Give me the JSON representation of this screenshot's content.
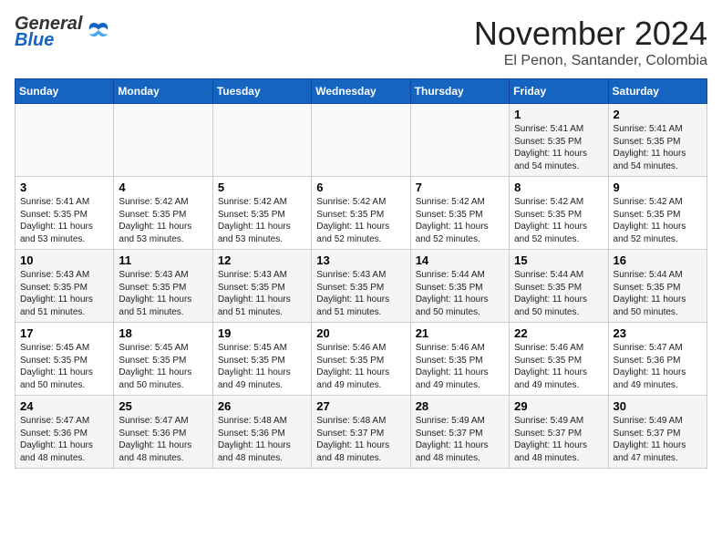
{
  "header": {
    "logo_general": "General",
    "logo_blue": "Blue",
    "month": "November 2024",
    "location": "El Penon, Santander, Colombia"
  },
  "weekdays": [
    "Sunday",
    "Monday",
    "Tuesday",
    "Wednesday",
    "Thursday",
    "Friday",
    "Saturday"
  ],
  "weeks": [
    [
      {
        "day": "",
        "info": ""
      },
      {
        "day": "",
        "info": ""
      },
      {
        "day": "",
        "info": ""
      },
      {
        "day": "",
        "info": ""
      },
      {
        "day": "",
        "info": ""
      },
      {
        "day": "1",
        "info": "Sunrise: 5:41 AM\nSunset: 5:35 PM\nDaylight: 11 hours and 54 minutes."
      },
      {
        "day": "2",
        "info": "Sunrise: 5:41 AM\nSunset: 5:35 PM\nDaylight: 11 hours and 54 minutes."
      }
    ],
    [
      {
        "day": "3",
        "info": "Sunrise: 5:41 AM\nSunset: 5:35 PM\nDaylight: 11 hours and 53 minutes."
      },
      {
        "day": "4",
        "info": "Sunrise: 5:42 AM\nSunset: 5:35 PM\nDaylight: 11 hours and 53 minutes."
      },
      {
        "day": "5",
        "info": "Sunrise: 5:42 AM\nSunset: 5:35 PM\nDaylight: 11 hours and 53 minutes."
      },
      {
        "day": "6",
        "info": "Sunrise: 5:42 AM\nSunset: 5:35 PM\nDaylight: 11 hours and 52 minutes."
      },
      {
        "day": "7",
        "info": "Sunrise: 5:42 AM\nSunset: 5:35 PM\nDaylight: 11 hours and 52 minutes."
      },
      {
        "day": "8",
        "info": "Sunrise: 5:42 AM\nSunset: 5:35 PM\nDaylight: 11 hours and 52 minutes."
      },
      {
        "day": "9",
        "info": "Sunrise: 5:42 AM\nSunset: 5:35 PM\nDaylight: 11 hours and 52 minutes."
      }
    ],
    [
      {
        "day": "10",
        "info": "Sunrise: 5:43 AM\nSunset: 5:35 PM\nDaylight: 11 hours and 51 minutes."
      },
      {
        "day": "11",
        "info": "Sunrise: 5:43 AM\nSunset: 5:35 PM\nDaylight: 11 hours and 51 minutes."
      },
      {
        "day": "12",
        "info": "Sunrise: 5:43 AM\nSunset: 5:35 PM\nDaylight: 11 hours and 51 minutes."
      },
      {
        "day": "13",
        "info": "Sunrise: 5:43 AM\nSunset: 5:35 PM\nDaylight: 11 hours and 51 minutes."
      },
      {
        "day": "14",
        "info": "Sunrise: 5:44 AM\nSunset: 5:35 PM\nDaylight: 11 hours and 50 minutes."
      },
      {
        "day": "15",
        "info": "Sunrise: 5:44 AM\nSunset: 5:35 PM\nDaylight: 11 hours and 50 minutes."
      },
      {
        "day": "16",
        "info": "Sunrise: 5:44 AM\nSunset: 5:35 PM\nDaylight: 11 hours and 50 minutes."
      }
    ],
    [
      {
        "day": "17",
        "info": "Sunrise: 5:45 AM\nSunset: 5:35 PM\nDaylight: 11 hours and 50 minutes."
      },
      {
        "day": "18",
        "info": "Sunrise: 5:45 AM\nSunset: 5:35 PM\nDaylight: 11 hours and 50 minutes."
      },
      {
        "day": "19",
        "info": "Sunrise: 5:45 AM\nSunset: 5:35 PM\nDaylight: 11 hours and 49 minutes."
      },
      {
        "day": "20",
        "info": "Sunrise: 5:46 AM\nSunset: 5:35 PM\nDaylight: 11 hours and 49 minutes."
      },
      {
        "day": "21",
        "info": "Sunrise: 5:46 AM\nSunset: 5:35 PM\nDaylight: 11 hours and 49 minutes."
      },
      {
        "day": "22",
        "info": "Sunrise: 5:46 AM\nSunset: 5:35 PM\nDaylight: 11 hours and 49 minutes."
      },
      {
        "day": "23",
        "info": "Sunrise: 5:47 AM\nSunset: 5:36 PM\nDaylight: 11 hours and 49 minutes."
      }
    ],
    [
      {
        "day": "24",
        "info": "Sunrise: 5:47 AM\nSunset: 5:36 PM\nDaylight: 11 hours and 48 minutes."
      },
      {
        "day": "25",
        "info": "Sunrise: 5:47 AM\nSunset: 5:36 PM\nDaylight: 11 hours and 48 minutes."
      },
      {
        "day": "26",
        "info": "Sunrise: 5:48 AM\nSunset: 5:36 PM\nDaylight: 11 hours and 48 minutes."
      },
      {
        "day": "27",
        "info": "Sunrise: 5:48 AM\nSunset: 5:37 PM\nDaylight: 11 hours and 48 minutes."
      },
      {
        "day": "28",
        "info": "Sunrise: 5:49 AM\nSunset: 5:37 PM\nDaylight: 11 hours and 48 minutes."
      },
      {
        "day": "29",
        "info": "Sunrise: 5:49 AM\nSunset: 5:37 PM\nDaylight: 11 hours and 48 minutes."
      },
      {
        "day": "30",
        "info": "Sunrise: 5:49 AM\nSunset: 5:37 PM\nDaylight: 11 hours and 47 minutes."
      }
    ]
  ]
}
